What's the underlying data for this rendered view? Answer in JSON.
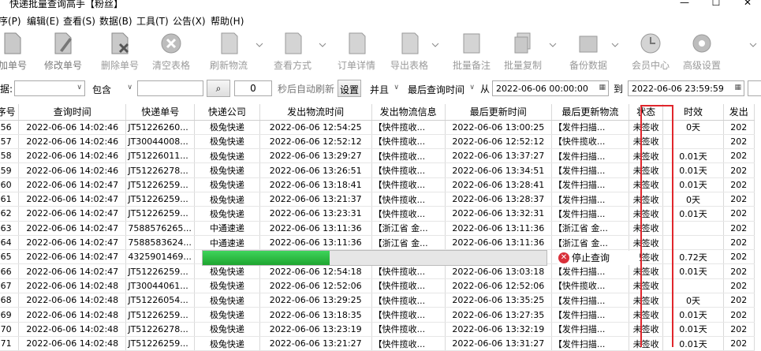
{
  "window": {
    "title": "快递批量查询高手【粉丝】",
    "minimize": "—",
    "maximize": "☐",
    "close": "✕"
  },
  "menu": [
    "序(P)",
    "编辑(E)",
    "查看(S)",
    "数据(B)",
    "工具(T)",
    "公告(X)",
    "帮助(H)"
  ],
  "toolbar": [
    {
      "label": "加单号",
      "icon": "add-document-icon"
    },
    {
      "label": "修改单号",
      "icon": "edit-document-icon"
    },
    {
      "label": "删除单号",
      "icon": "delete-document-icon"
    },
    {
      "label": "清空表格",
      "icon": "clear-icon"
    },
    {
      "label": "刷新物流",
      "icon": "refresh-icon"
    },
    {
      "label": "查看方式",
      "icon": "view-icon"
    },
    {
      "label": "订单详情",
      "icon": "order-detail-icon"
    },
    {
      "label": "导出表格",
      "icon": "export-icon"
    },
    {
      "label": "批量备注",
      "icon": "note-icon"
    },
    {
      "label": "批量复制",
      "icon": "copy-icon"
    },
    {
      "label": "备份数据",
      "icon": "backup-icon"
    },
    {
      "label": "会员中心",
      "icon": "clock-icon"
    },
    {
      "label": "高级设置",
      "icon": "settings-icon"
    }
  ],
  "filter": {
    "field_label": "据:",
    "field_value": "",
    "match_mode": "包含",
    "keyword": "",
    "search_icon": "search-icon",
    "refresh_seconds": "0",
    "auto_refresh_label": "秒后自动刷新",
    "settings_button": "设置",
    "logic": "并且",
    "time_field": "最后查询时间",
    "from_label": "从",
    "from_value": "2022-06-06 00:00:00",
    "to_label": "到",
    "to_value": "2022-06-06 23:59:59"
  },
  "table": {
    "columns": [
      "序号",
      "查询时间",
      "快递单号",
      "快递公司",
      "发出物流时间",
      "发出物流信息",
      "最后更新时间",
      "最后更新物流",
      "状态",
      "时效",
      "发出"
    ],
    "rows": [
      [
        "56",
        "2022-06-06 14:02:46",
        "JT51226260...",
        "极兔快递",
        "2022-06-06 12:54:25",
        "【快件揽收...",
        "2022-06-06 13:00:25",
        "【发件扫描...",
        "未签收",
        "0天",
        "202"
      ],
      [
        "57",
        "2022-06-06 14:02:46",
        "JT30044008...",
        "极兔快递",
        "2022-06-06 12:52:12",
        "【快件揽收...",
        "2022-06-06 12:52:12",
        "【快件揽收...",
        "未签收",
        "",
        "202"
      ],
      [
        "58",
        "2022-06-06 14:02:46",
        "JT51226011...",
        "极兔快递",
        "2022-06-06 13:29:27",
        "【快件揽收...",
        "2022-06-06 13:37:27",
        "【发件扫描...",
        "未签收",
        "0.01天",
        "202"
      ],
      [
        "59",
        "2022-06-06 14:02:46",
        "JT51226278...",
        "极兔快递",
        "2022-06-06 13:26:51",
        "【快件揽收...",
        "2022-06-06 13:34:51",
        "【发件扫描...",
        "未签收",
        "0.01天",
        "202"
      ],
      [
        "60",
        "2022-06-06 14:02:47",
        "JT51226259...",
        "极兔快递",
        "2022-06-06 13:18:41",
        "【快件揽收...",
        "2022-06-06 13:28:41",
        "【发件扫描...",
        "未签收",
        "0.01天",
        "202"
      ],
      [
        "61",
        "2022-06-06 14:02:47",
        "JT51226259...",
        "极兔快递",
        "2022-06-06 13:21:37",
        "【快件揽收...",
        "2022-06-06 13:28:37",
        "【发件扫描...",
        "未签收",
        "0天",
        "202"
      ],
      [
        "62",
        "2022-06-06 14:02:47",
        "JT51226259...",
        "极兔快递",
        "2022-06-06 13:23:31",
        "【快件揽收...",
        "2022-06-06 13:32:31",
        "【发件扫描...",
        "未签收",
        "0.01天",
        "202"
      ],
      [
        "63",
        "2022-06-06 14:02:47",
        "7588576265...",
        "中通速递",
        "2022-06-06 13:11:36",
        "【浙江省 金...",
        "2022-06-06 13:11:36",
        "【浙江省 金...",
        "未签收",
        "",
        "202"
      ],
      [
        "64",
        "2022-06-06 14:02:47",
        "7588583624...",
        "中通速递",
        "2022-06-06 13:11:36",
        "【浙江省 金...",
        "2022-06-06 13:11:36",
        "【浙江省 金...",
        "未签收",
        "",
        "202"
      ],
      [
        "65",
        "2022-06-06 14:02:47",
        "4325901469...",
        "",
        "",
        "",
        "",
        "",
        "已签收",
        "0.72天",
        "202"
      ],
      [
        "66",
        "2022-06-06 14:02:47",
        "JT51226259...",
        "极兔快递",
        "2022-06-06 12:54:18",
        "【快件揽收...",
        "2022-06-06 13:03:18",
        "【发件扫描...",
        "未签收",
        "0.01天",
        "202"
      ],
      [
        "67",
        "2022-06-06 14:02:48",
        "JT30044061...",
        "极兔快递",
        "2022-06-06 12:52:06",
        "【快件揽收...",
        "2022-06-06 12:52:06",
        "【快件揽收...",
        "未签收",
        "",
        "202"
      ],
      [
        "68",
        "2022-06-06 14:02:48",
        "JT51226054...",
        "极兔快递",
        "2022-06-06 13:29:25",
        "【快件揽收...",
        "2022-06-06 13:35:25",
        "【发件扫描...",
        "未签收",
        "0天",
        "202"
      ],
      [
        "69",
        "2022-06-06 14:02:48",
        "JT51226259...",
        "极兔快递",
        "2022-06-06 13:18:35",
        "【快件揽收...",
        "2022-06-06 13:27:35",
        "【发件扫描...",
        "未签收",
        "0.01天",
        "202"
      ],
      [
        "70",
        "2022-06-06 14:02:48",
        "JT51226278...",
        "极兔快递",
        "2022-06-06 13:23:19",
        "【快件揽收...",
        "2022-06-06 13:32:19",
        "【发件扫描...",
        "未签收",
        "0.01天",
        "202"
      ],
      [
        "71",
        "2022-06-06 14:02:48",
        "JT51226259...",
        "极兔快递",
        "2022-06-06 13:21:27",
        "【快件揽收...",
        "2022-06-06 13:31:27",
        "【发件扫描...",
        "未签收",
        "0.01天",
        "202"
      ]
    ]
  },
  "progress": {
    "fraction": 0.37,
    "stop_label": "停止查询"
  },
  "colors": {
    "status_highlight": "#e0262c",
    "progress_fill": "#2cc142"
  }
}
